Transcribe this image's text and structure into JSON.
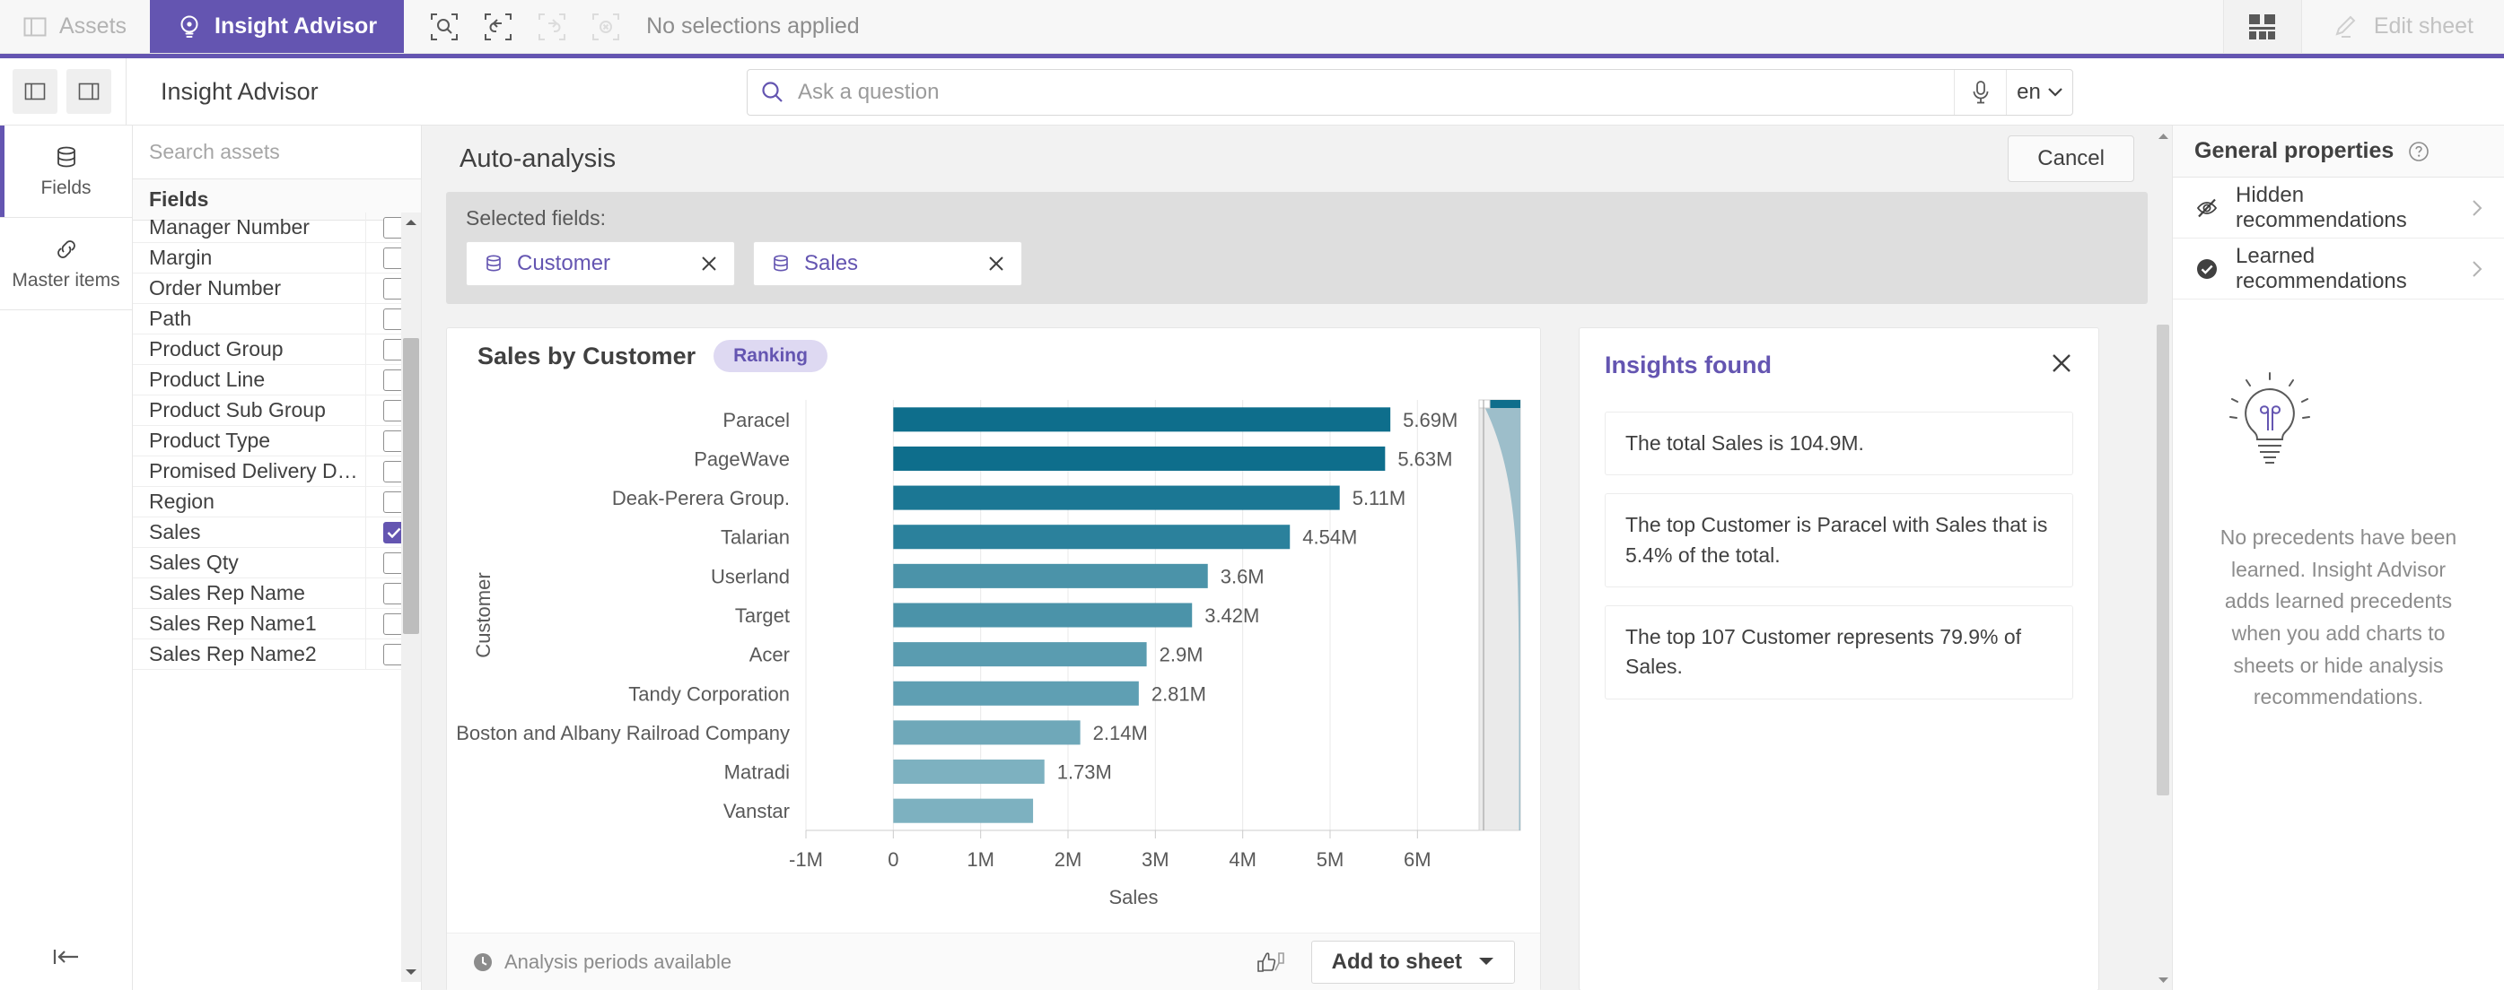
{
  "topbar": {
    "assets_label": "Assets",
    "insight_advisor_label": "Insight Advisor",
    "selection_status": "No selections applied",
    "edit_sheet_label": "Edit sheet",
    "accent": "#6455b1"
  },
  "header": {
    "title": "Insight Advisor",
    "search_placeholder": "Ask a question",
    "search_value": "",
    "language": "en"
  },
  "rail": {
    "items": [
      {
        "label": "Fields",
        "icon": "database-icon",
        "active": true
      },
      {
        "label": "Master items",
        "icon": "link-icon",
        "active": false
      }
    ]
  },
  "assets": {
    "search_placeholder": "Search assets",
    "section_header": "Fields",
    "fields": [
      {
        "name": "Manager Number",
        "checked": false
      },
      {
        "name": "Margin",
        "checked": false
      },
      {
        "name": "Order Number",
        "checked": false
      },
      {
        "name": "Path",
        "checked": false
      },
      {
        "name": "Product Group",
        "checked": false
      },
      {
        "name": "Product Line",
        "checked": false
      },
      {
        "name": "Product Sub Group",
        "checked": false
      },
      {
        "name": "Product Type",
        "checked": false
      },
      {
        "name": "Promised Delivery D…",
        "checked": false
      },
      {
        "name": "Region",
        "checked": false
      },
      {
        "name": "Sales",
        "checked": true
      },
      {
        "name": "Sales Qty",
        "checked": false
      },
      {
        "name": "Sales Rep Name",
        "checked": false
      },
      {
        "name": "Sales Rep Name1",
        "checked": false
      },
      {
        "name": "Sales Rep Name2",
        "checked": false
      }
    ]
  },
  "main": {
    "title": "Auto-analysis",
    "cancel_label": "Cancel",
    "selected_fields_label": "Selected fields:",
    "selected_fields": [
      {
        "label": "Customer"
      },
      {
        "label": "Sales"
      }
    ]
  },
  "chart_card": {
    "title": "Sales by Customer",
    "badge": "Ranking",
    "footer_note": "Analysis periods available",
    "add_to_sheet_label": "Add to sheet"
  },
  "chart_data": {
    "type": "bar",
    "orientation": "horizontal",
    "title": "Sales by Customer",
    "xlabel": "Sales",
    "ylabel": "Customer",
    "xlim": [
      -1000000,
      6500000
    ],
    "xticks": [
      "-1M",
      "0",
      "1M",
      "2M",
      "3M",
      "4M",
      "5M",
      "6M"
    ],
    "xtick_values": [
      -1000000,
      0,
      1000000,
      2000000,
      3000000,
      4000000,
      5000000,
      6000000
    ],
    "grid": true,
    "legend": "none",
    "categories": [
      "Paracel",
      "PageWave",
      "Deak-Perera Group.",
      "Talarian",
      "Userland",
      "Target",
      "Acer",
      "Tandy Corporation",
      "Boston and Albany Railroad Company",
      "Matradi",
      "Vanstar"
    ],
    "values": [
      5690000,
      5630000,
      5110000,
      4540000,
      3600000,
      3420000,
      2900000,
      2810000,
      2140000,
      1730000,
      1600000
    ],
    "data_labels": [
      "5.69M",
      "5.63M",
      "5.11M",
      "4.54M",
      "3.6M",
      "3.42M",
      "2.9M",
      "2.81M",
      "2.14M",
      "1.73M",
      ""
    ],
    "bar_colors": [
      "#0e6e8c",
      "#0e6e8c",
      "#1b7794",
      "#2b819c",
      "#4b93a9",
      "#4b93a9",
      "#5a9cb0",
      "#5f9fb3",
      "#6fa8b9",
      "#7db1c0",
      "#7db1c0"
    ]
  },
  "insights": {
    "title": "Insights found",
    "items": [
      "The total Sales is 104.9M.",
      "The top Customer is Paracel with Sales that is 5.4% of the total.",
      "The top 107 Customer represents 79.9% of Sales."
    ]
  },
  "properties": {
    "title": "General properties",
    "rows": [
      {
        "label": "Hidden recommendations",
        "icon": "eye-off-icon"
      },
      {
        "label": "Learned recommendations",
        "icon": "check-circle-icon"
      }
    ],
    "empty_text": "No precedents have been learned. Insight Advisor adds learned precedents when you add charts to sheets or hide analysis recommendations."
  }
}
